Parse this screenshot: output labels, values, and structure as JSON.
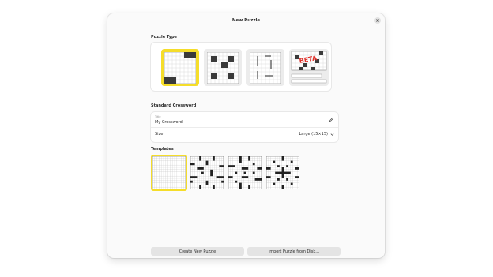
{
  "dialog": {
    "title": "New Puzzle"
  },
  "puzzle_type": {
    "heading": "Puzzle Type",
    "beta_badge": "BETA",
    "options": [
      {
        "icon": "crossword-grid-icon",
        "selected": true
      },
      {
        "icon": "barred-grid-icon",
        "selected": false
      },
      {
        "icon": "line-grid-icon",
        "selected": false
      },
      {
        "icon": "beta-puzzle-icon",
        "selected": false
      }
    ]
  },
  "settings": {
    "heading": "Standard Crossword",
    "title_caption": "Title",
    "title_value": "My Crossword",
    "size_label": "Size",
    "size_value": "Large (15×15)"
  },
  "templates": {
    "heading": "Templates",
    "count": 4,
    "selected_index": 0
  },
  "buttons": {
    "create": "Create New Puzzle",
    "import": "Import Puzzle from Disk…"
  },
  "colors": {
    "accent": "#f5dd2a",
    "dialog_bg": "#fafafa",
    "button_bg": "#e4e4e4"
  }
}
